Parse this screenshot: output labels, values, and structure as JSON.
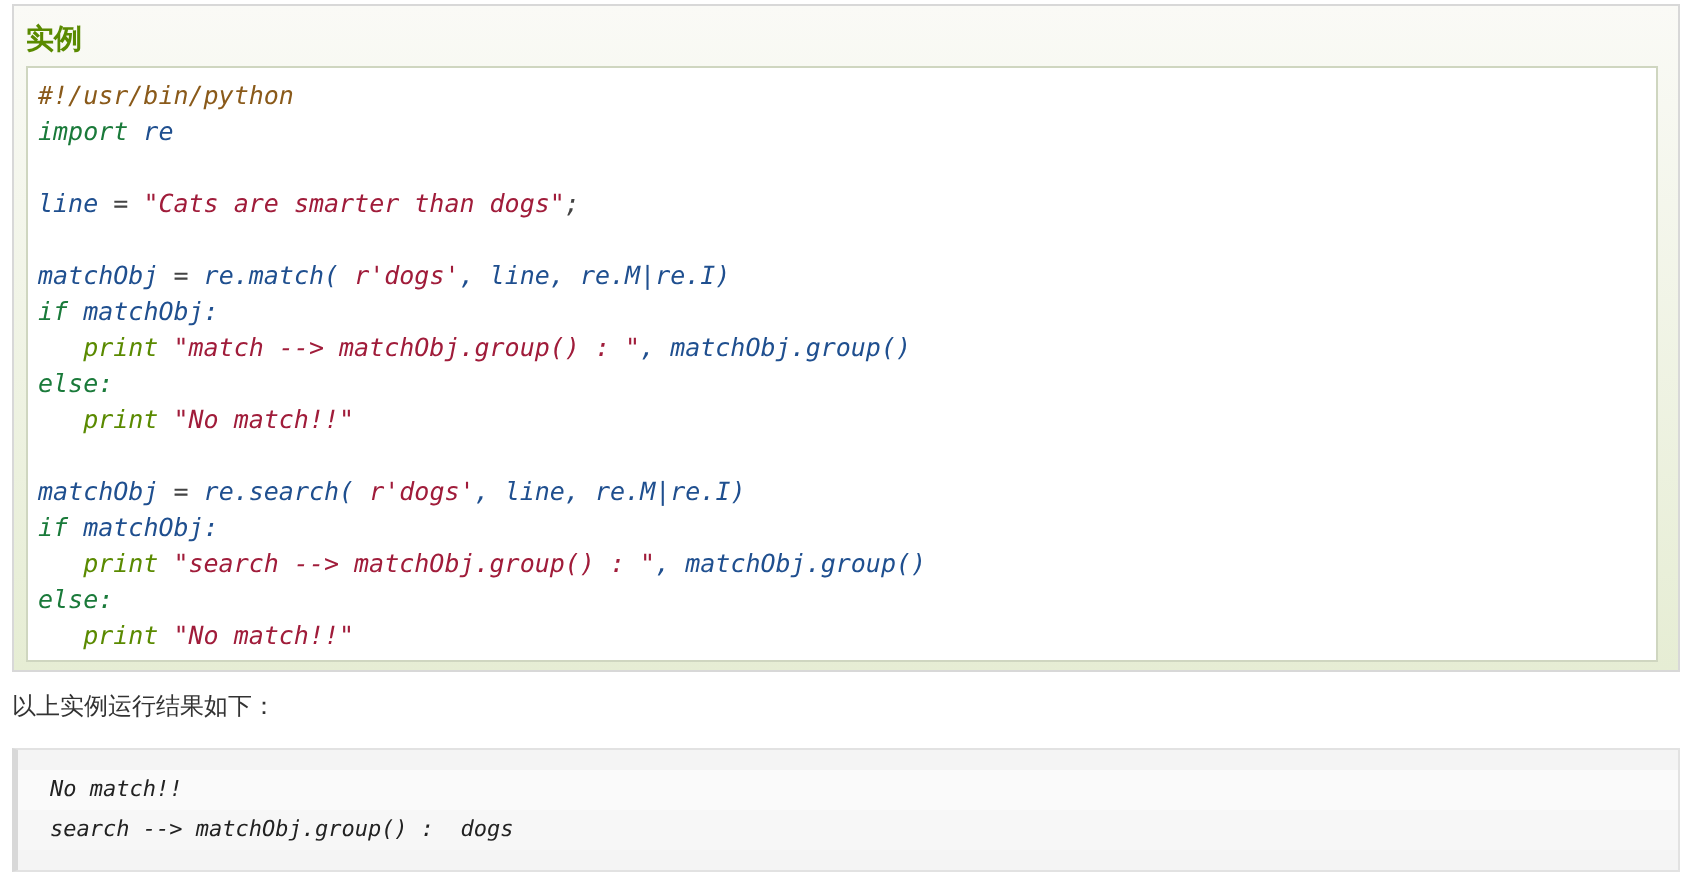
{
  "example": {
    "title": "实例",
    "code_lines": [
      {
        "kind": "code",
        "indented": false,
        "tokens": [
          {
            "kind": "comment",
            "text": "#!/usr/bin/python"
          }
        ]
      },
      {
        "kind": "code",
        "indented": false,
        "tokens": [
          {
            "kind": "keyword",
            "text": "import"
          },
          {
            "kind": "name",
            "text": " re"
          }
        ]
      },
      {
        "kind": "blank"
      },
      {
        "kind": "code",
        "indented": false,
        "tokens": [
          {
            "kind": "name",
            "text": "line"
          },
          {
            "kind": "punct",
            "text": " = "
          },
          {
            "kind": "string",
            "text": "\"Cats are smarter than dogs\""
          },
          {
            "kind": "punct",
            "text": ";"
          }
        ]
      },
      {
        "kind": "blank"
      },
      {
        "kind": "code",
        "indented": false,
        "tokens": [
          {
            "kind": "name",
            "text": "matchObj"
          },
          {
            "kind": "punct",
            "text": " = "
          },
          {
            "kind": "name",
            "text": "re.match( "
          },
          {
            "kind": "string",
            "text": "r'dogs'"
          },
          {
            "kind": "name",
            "text": ", line, re.M|re.I)"
          }
        ]
      },
      {
        "kind": "code",
        "indented": false,
        "tokens": [
          {
            "kind": "keyword",
            "text": "if"
          },
          {
            "kind": "name",
            "text": " matchObj:"
          }
        ]
      },
      {
        "kind": "code",
        "indented": true,
        "tokens": [
          {
            "kind": "builtin",
            "text": "print"
          },
          {
            "kind": "string",
            "text": " \"match --> matchObj.group() : \""
          },
          {
            "kind": "name",
            "text": ", matchObj.group()"
          }
        ]
      },
      {
        "kind": "code",
        "indented": false,
        "tokens": [
          {
            "kind": "keyword",
            "text": "else:"
          }
        ]
      },
      {
        "kind": "code",
        "indented": true,
        "tokens": [
          {
            "kind": "builtin",
            "text": "print"
          },
          {
            "kind": "string",
            "text": " \"No match!!\""
          }
        ]
      },
      {
        "kind": "blank"
      },
      {
        "kind": "code",
        "indented": false,
        "tokens": [
          {
            "kind": "name",
            "text": "matchObj"
          },
          {
            "kind": "punct",
            "text": " = "
          },
          {
            "kind": "name",
            "text": "re.search( "
          },
          {
            "kind": "string",
            "text": "r'dogs'"
          },
          {
            "kind": "name",
            "text": ", line, re.M|re.I)"
          }
        ]
      },
      {
        "kind": "code",
        "indented": false,
        "tokens": [
          {
            "kind": "keyword",
            "text": "if"
          },
          {
            "kind": "name",
            "text": " matchObj:"
          }
        ]
      },
      {
        "kind": "code",
        "indented": true,
        "tokens": [
          {
            "kind": "builtin",
            "text": "print"
          },
          {
            "kind": "string",
            "text": " \"search --> matchObj.group() : \""
          },
          {
            "kind": "name",
            "text": ", matchObj.group()"
          }
        ]
      },
      {
        "kind": "code",
        "indented": false,
        "tokens": [
          {
            "kind": "keyword",
            "text": "else:"
          }
        ]
      },
      {
        "kind": "code",
        "indented": true,
        "tokens": [
          {
            "kind": "builtin",
            "text": "print"
          },
          {
            "kind": "string",
            "text": " \"No match!!\""
          }
        ]
      }
    ]
  },
  "result_intro": "以上实例运行结果如下：",
  "output_lines": [
    "No match!!",
    "search --> matchObj.group() :  dogs"
  ]
}
